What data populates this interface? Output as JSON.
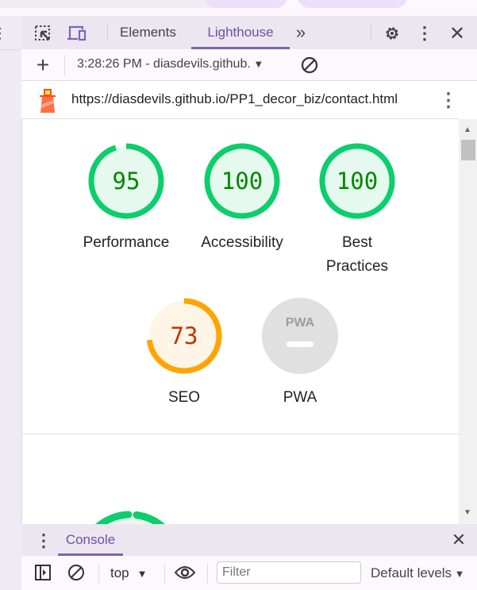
{
  "devtools": {
    "tabs": [
      {
        "label": "Elements",
        "active": false
      },
      {
        "label": "Lighthouse",
        "active": true
      }
    ],
    "more_tabs": "»"
  },
  "report_bar": {
    "selected_report": "3:28:26 PM - diasdevils.github.",
    "url": "https://diasdevils.github.io/PP1_decor_biz/contact.html"
  },
  "scores": [
    {
      "label": "Performance",
      "value": "95",
      "score": 95,
      "color": "#0cce6b",
      "text_color": "#008800",
      "bg": "#e5f9ee"
    },
    {
      "label": "Accessibility",
      "value": "100",
      "score": 100,
      "color": "#0cce6b",
      "text_color": "#008800",
      "bg": "#e5f9ee"
    },
    {
      "label": "Best Practices",
      "value": "100",
      "score": 100,
      "color": "#0cce6b",
      "text_color": "#008800",
      "bg": "#e5f9ee"
    },
    {
      "label": "SEO",
      "value": "73",
      "score": 73,
      "color": "#ffa400",
      "text_color": "#c33300",
      "bg": "#fff5e6"
    },
    {
      "label": "PWA",
      "value": "PWA",
      "score": null,
      "color": "#e0e0e0",
      "text_color": "#9e9e9e",
      "bg": "#e0e0e0"
    }
  ],
  "bottom_gauge": {
    "score": null,
    "color": "#0cce6b"
  },
  "drawer": {
    "tab": "Console",
    "context": "top",
    "filter_placeholder": "Filter",
    "levels": "Default levels"
  }
}
